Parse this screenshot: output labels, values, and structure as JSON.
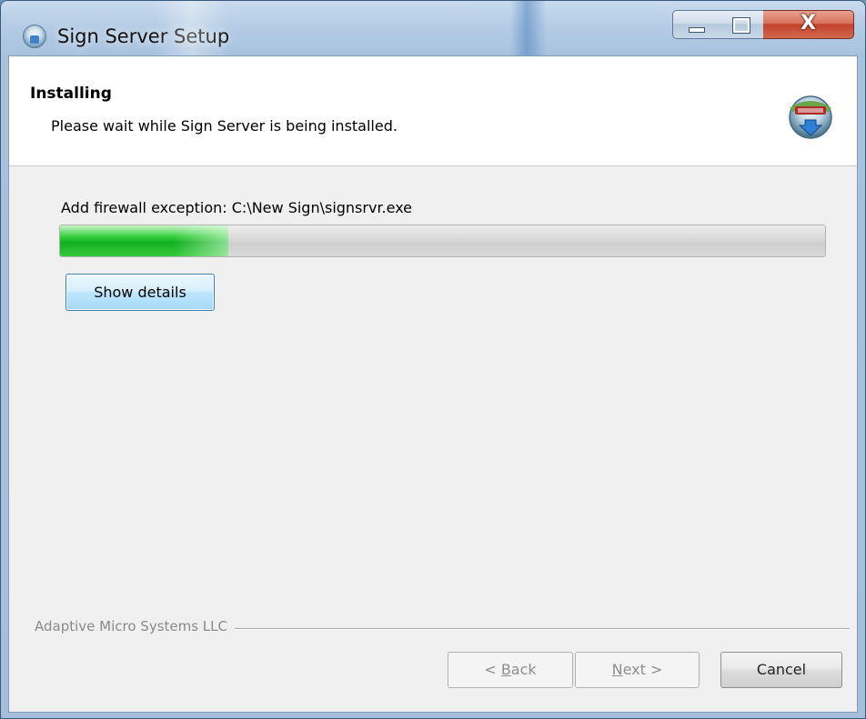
{
  "window": {
    "title": "Sign Server Setup",
    "close_glyph": "X"
  },
  "header": {
    "title": "Installing",
    "subtitle": "Please wait while Sign Server is being installed."
  },
  "progress": {
    "status_text": "Add firewall exception: C:\\New Sign\\signsrvr.exe",
    "fraction": 0.22,
    "accent": "#22bb2a"
  },
  "buttons": {
    "show_details": "Show details",
    "back_prefix": "< ",
    "back_access": "B",
    "back_rest": "ack",
    "next_access": "N",
    "next_rest": "ext >",
    "cancel": "Cancel"
  },
  "footer": {
    "branding": "Adaptive Micro Systems LLC"
  },
  "icons": {
    "app": "installer-globe-icon",
    "header": "install-download-icon",
    "minimize": "minimize-icon",
    "maximize": "maximize-icon",
    "close": "close-icon"
  }
}
